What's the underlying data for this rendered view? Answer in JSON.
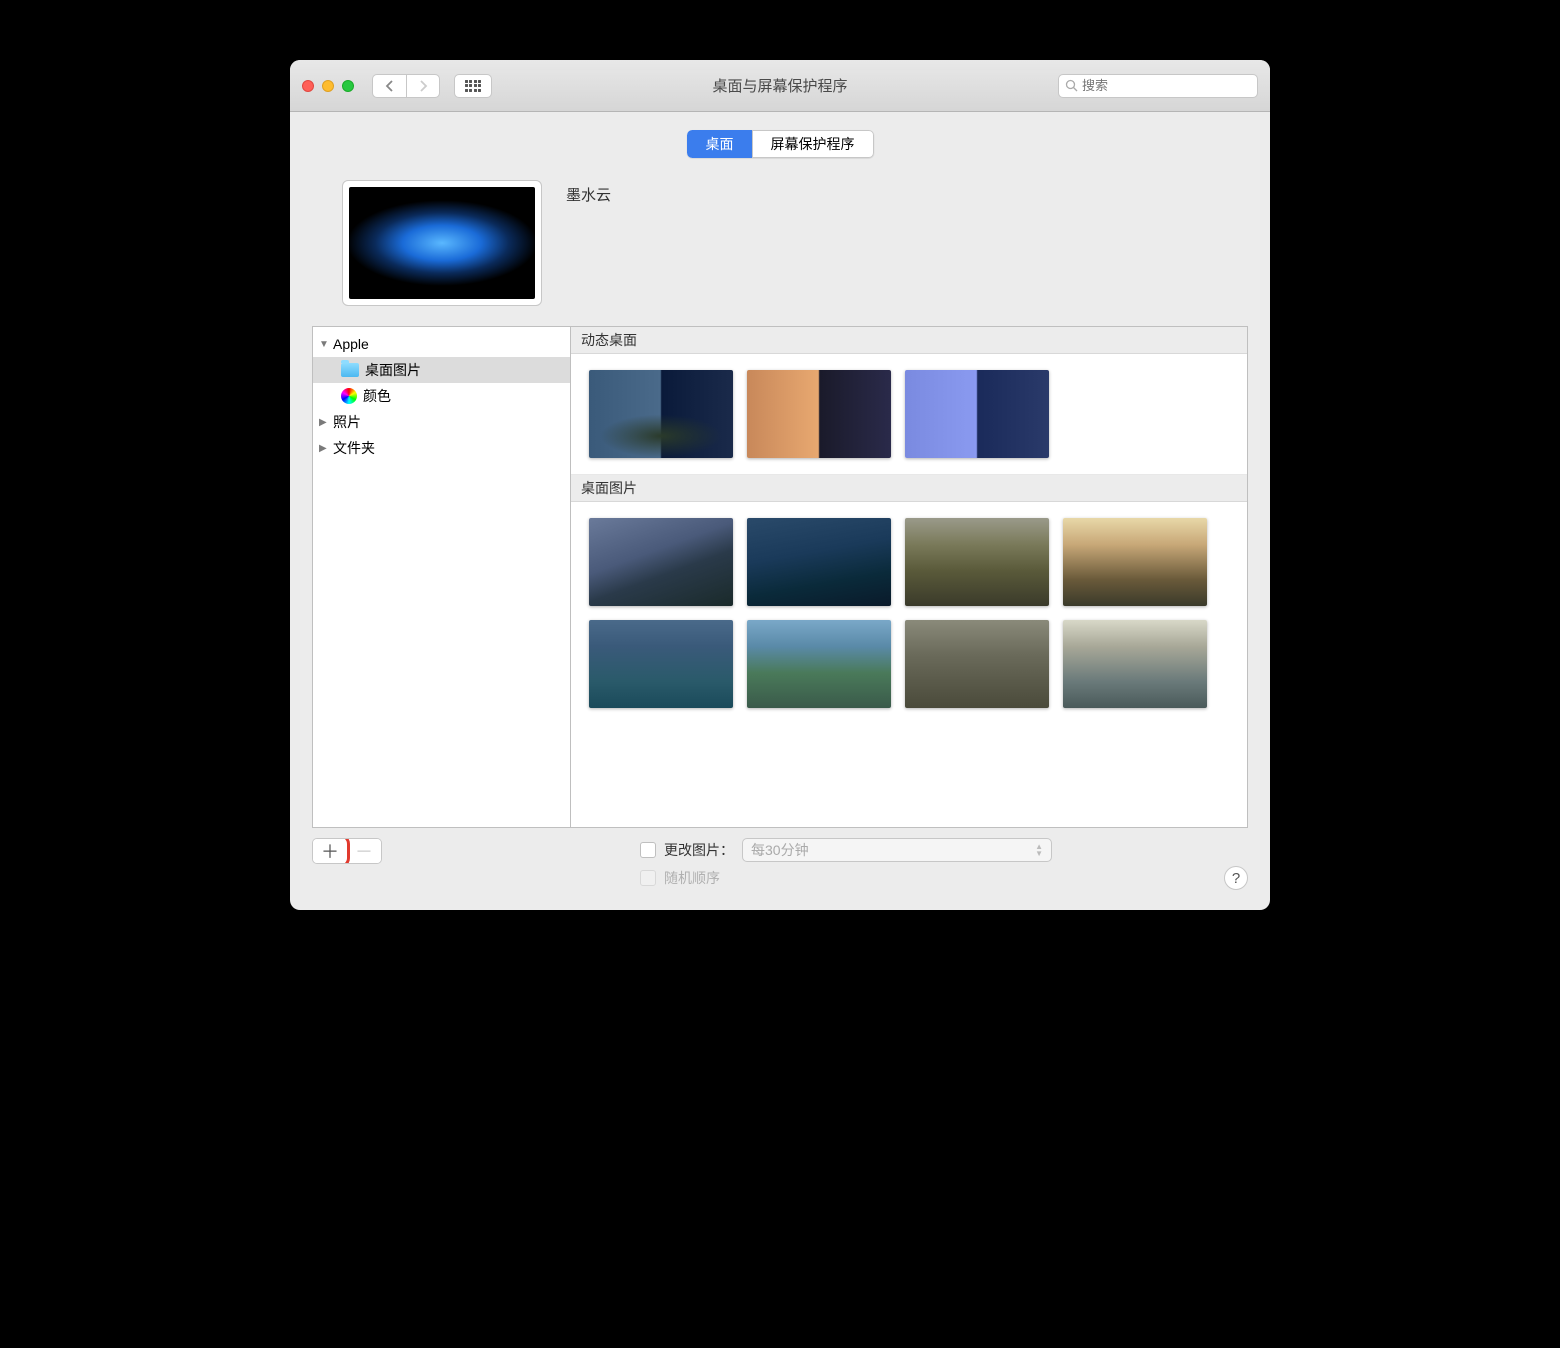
{
  "window": {
    "title": "桌面与屏幕保护程序"
  },
  "search": {
    "placeholder": "搜索"
  },
  "tabs": {
    "desktop": "桌面",
    "screensaver": "屏幕保护程序"
  },
  "current_wallpaper": {
    "name": "墨水云"
  },
  "sidebar": {
    "apple": "Apple",
    "desktop_pictures": "桌面图片",
    "colors": "颜色",
    "photos": "照片",
    "folders": "文件夹"
  },
  "sections": {
    "dynamic": "动态桌面",
    "pictures": "桌面图片"
  },
  "options": {
    "change_picture": "更改图片：",
    "interval": "每30分钟",
    "random": "随机顺序"
  },
  "help": "?"
}
